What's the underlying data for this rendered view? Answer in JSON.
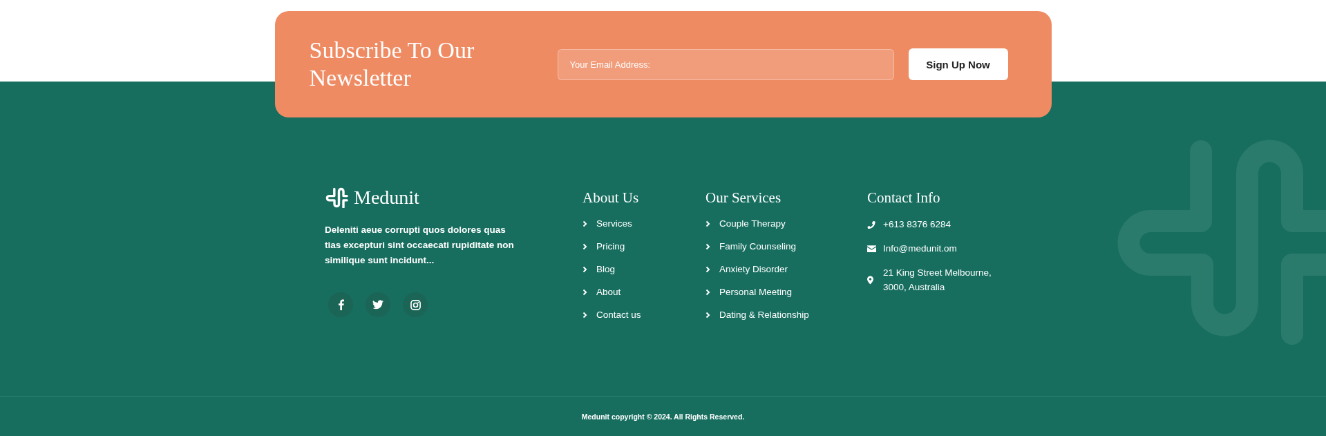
{
  "newsletter": {
    "title": "Subscribe To Our Newsletter",
    "email_field": {
      "placeholder": "Your Email Address:"
    },
    "button": "Sign Up Now"
  },
  "brand": {
    "name": "Medunit",
    "description": "Deleniti aeue corrupti quos dolores quas tias excepturi sint occaecati rupiditate non similique sunt incidunt...",
    "social_links": [
      {
        "kind": "facebook"
      },
      {
        "kind": "twitter"
      },
      {
        "kind": "instagram"
      }
    ]
  },
  "link_columns": [
    {
      "title": "About Us",
      "links": [
        "Services",
        "Pricing",
        "Blog",
        "About",
        "Contact us"
      ]
    },
    {
      "title": "Our Services",
      "links": [
        "Couple Therapy",
        "Family Counseling",
        "Anxiety Disorder",
        "Personal Meeting",
        "Dating & Relationship"
      ]
    }
  ],
  "contact_info": {
    "title": "Contact Info",
    "items": [
      {
        "kind": "phone",
        "text": "+613 8376 6284"
      },
      {
        "kind": "email",
        "text": "Info@medunit.om"
      },
      {
        "kind": "address",
        "text": "21 King Street Melbourne, 3000, Australia"
      }
    ]
  },
  "copyright": "Medunit copyright © 2024. All Rights Reserved."
}
